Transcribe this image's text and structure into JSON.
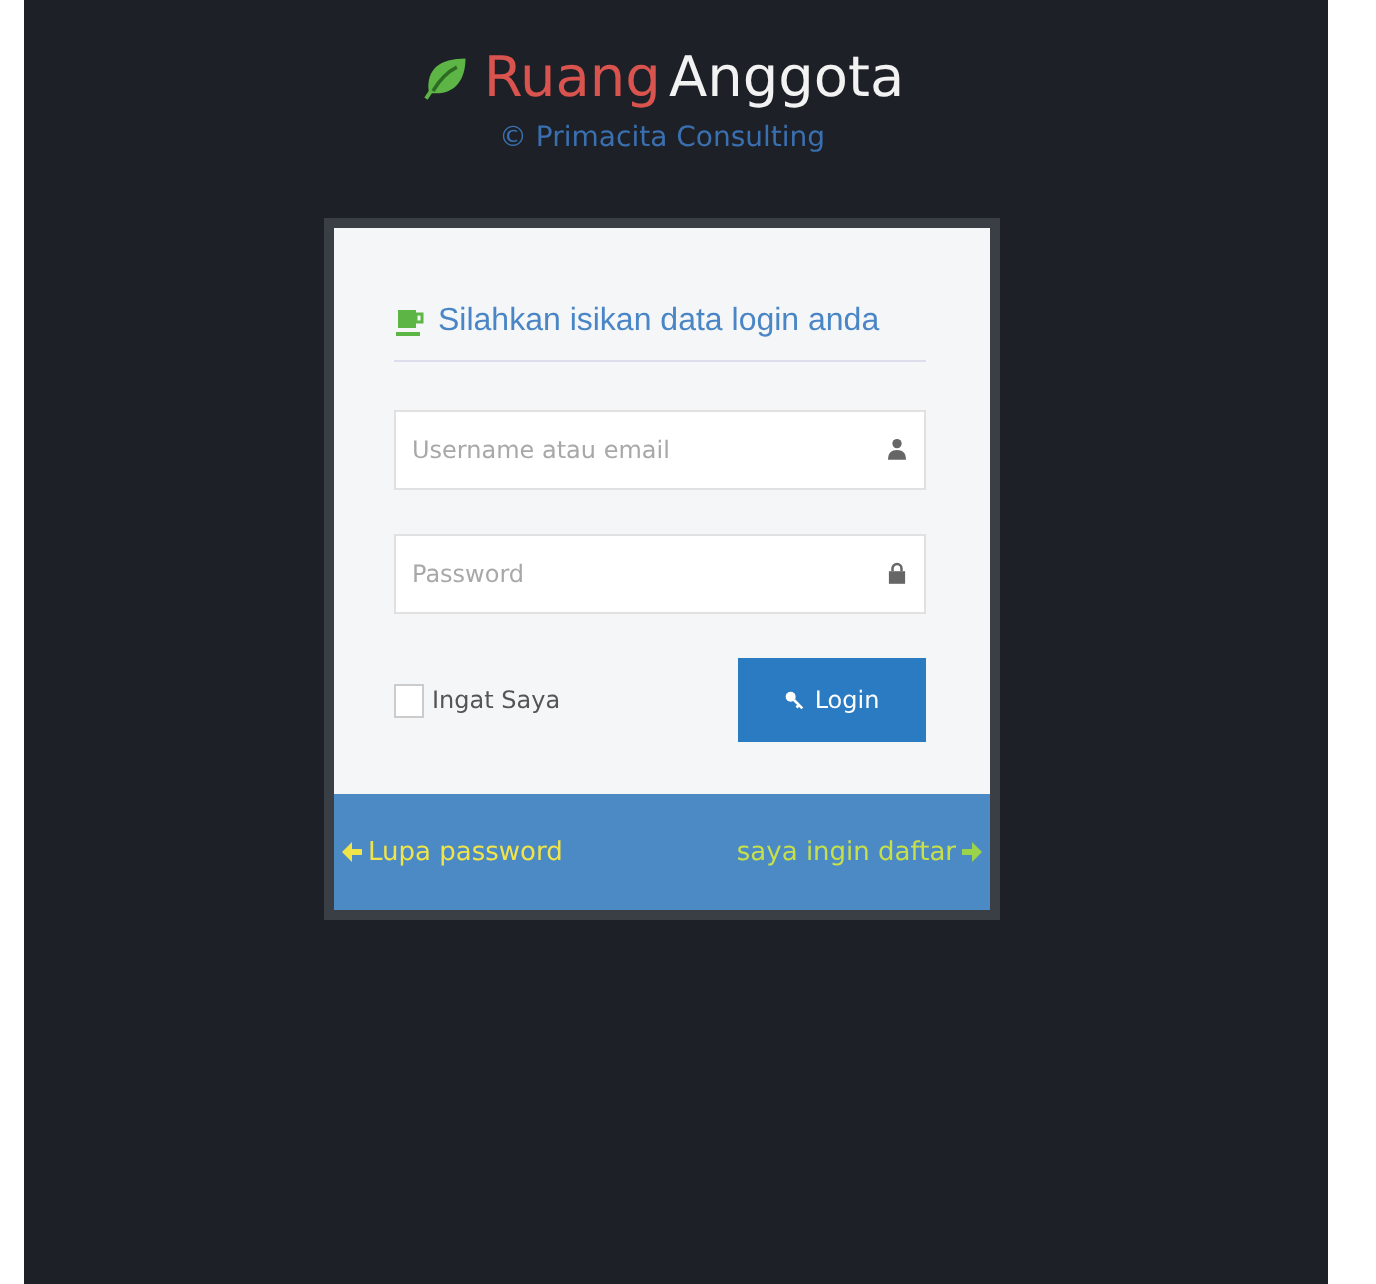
{
  "brand": {
    "title_first": "Ruang",
    "title_second": "Anggota",
    "subtitle": "© Primacita Consulting"
  },
  "login": {
    "heading": "Silahkan isikan data login anda",
    "fields": [
      {
        "kind": "user",
        "placeholder": "Username atau email"
      },
      {
        "kind": "password",
        "placeholder": "Password"
      }
    ],
    "remember": {
      "label": "Ingat Saya",
      "checked": false
    },
    "button": "Login"
  },
  "footer": {
    "left_link": "Lupa password",
    "right_link": "saya ingin daftar"
  }
}
